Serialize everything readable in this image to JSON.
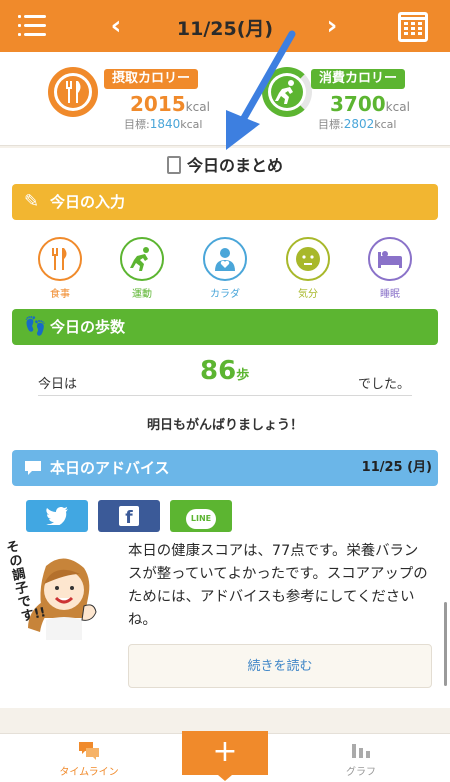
{
  "header": {
    "date": "11/25(月)",
    "prev": "‹",
    "next": "›"
  },
  "intake": {
    "label": "摂取カロリー",
    "value": "2015",
    "unit": "kcal",
    "goal_label": "目標:",
    "goal": "1840",
    "goal_unit": "kcal"
  },
  "burned": {
    "label": "消費カロリー",
    "value": "3700",
    "unit": "kcal",
    "goal_label": "目標:",
    "goal": "2802",
    "goal_unit": "kcal"
  },
  "summary_title": "今日のまとめ",
  "input_section": {
    "title": "今日の入力",
    "items": [
      {
        "label": "食事",
        "color": "#f08a2b",
        "icon": "fork-knife-icon"
      },
      {
        "label": "運動",
        "color": "#5cb531",
        "icon": "runner-icon"
      },
      {
        "label": "カラダ",
        "color": "#4aa6d9",
        "icon": "person-heart-icon"
      },
      {
        "label": "気分",
        "color": "#a8b82a",
        "icon": "face-icon"
      },
      {
        "label": "睡眠",
        "color": "#8a72c9",
        "icon": "bed-icon"
      }
    ]
  },
  "steps_section": {
    "title": "今日の歩数",
    "prefix": "今日は",
    "value": "86",
    "unit": "歩",
    "suffix": "でした。",
    "cheer": "明日もがんばりましょう！"
  },
  "advice_section": {
    "title": "本日のアドバイス",
    "date": "11/25 (月)",
    "share": {
      "twitter": "twitter-icon",
      "facebook": "f",
      "line": "LINE"
    },
    "illustration_caption": "その調子です!!",
    "text": "本日の健康スコアは、77点です。栄養バランスが整っていてよかったです。スコアアップのためには、アドバイスも参考にしてくださいね。",
    "more": "続きを読む"
  },
  "nav": {
    "timeline": "タイムライン",
    "plus": "+",
    "graph": "グラフ"
  },
  "colors": {
    "brand": "#f08a2b",
    "green": "#5cb531",
    "blue": "#6bb6e8",
    "yellow": "#f2b631",
    "annotation_arrow": "#3d7fe0"
  }
}
